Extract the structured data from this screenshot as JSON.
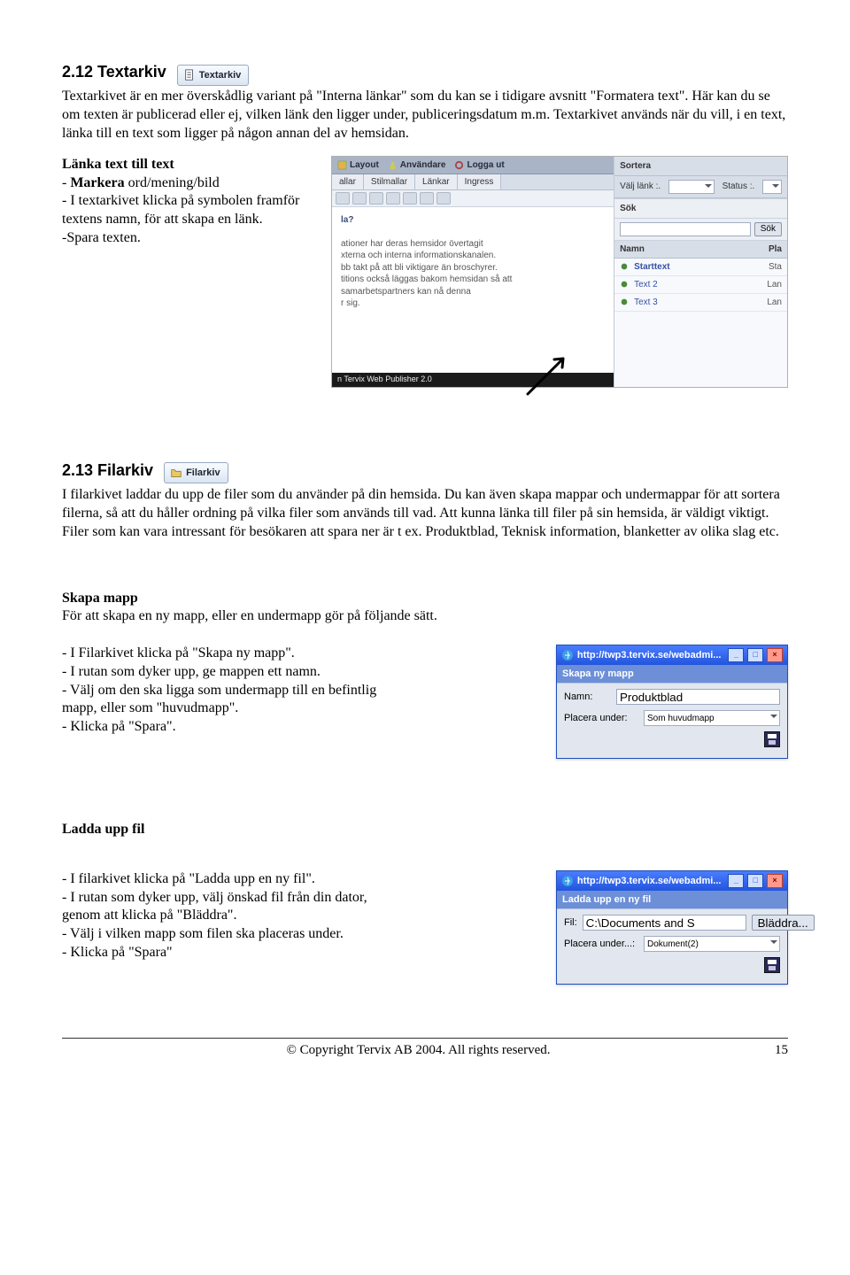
{
  "sections": {
    "textarkiv": {
      "heading": "2.12  Textarkiv",
      "badge": "Textarkiv",
      "p1": "Textarkivet är en mer överskådlig variant på \"Interna länkar\" som du kan se i tidigare avsnitt \"Formatera text\". Här kan du se om texten är publicerad eller ej, vilken länk den ligger under, publiceringsdatum m.m. Textarkivet används när du vill, i en text, länka till en text som ligger på någon annan del av hemsidan.",
      "sub_head": "Länka text till text",
      "steps": [
        "- Markera ord/mening/bild",
        "- I textarkivet klicka på symbolen framför textens namn, för att skapa en länk.",
        "-Spara texten."
      ]
    },
    "filarkiv": {
      "heading": "2.13  Filarkiv",
      "badge": "Filarkiv",
      "p1": "I filarkivet laddar du upp de filer som du använder på din hemsida. Du kan även skapa mappar och undermappar för att sortera filerna, så att du håller ordning på vilka filer som används till vad. Att kunna länka till filer på sin hemsida, är väldigt viktigt. Filer som kan vara intressant för besökaren att spara ner är t ex. Produktblad, Teknisk information, blanketter av olika slag etc.",
      "skapa_head": "Skapa mapp",
      "skapa_p": "För att skapa en ny mapp, eller en undermapp gör på följande sätt.",
      "skapa_steps": [
        "- I Filarkivet klicka på \"Skapa ny mapp\".",
        "- I rutan som dyker upp, ge mappen ett namn.",
        "- Välj om den ska ligga som undermapp till en befintlig mapp, eller som \"huvudmapp\".",
        "- Klicka på \"Spara\"."
      ],
      "ladda_head": "Ladda upp fil",
      "ladda_steps": [
        "- I filarkivet klicka på \"Ladda upp en ny fil\".",
        "- I rutan som dyker upp, välj önskad fil från din dator, genom att klicka på \"Bläddra\".",
        "- Välj i vilken mapp som filen ska placeras under.",
        "- Klicka på \"Spara\""
      ]
    }
  },
  "editor": {
    "toolbar": [
      "Layout",
      "Användare",
      "Logga ut"
    ],
    "tabs": [
      "allar",
      "Stilmallar",
      "Länkar",
      "Ingress"
    ],
    "body_q": "la?",
    "body_lines": [
      "ationer har deras hemsidor övertagit",
      "xterna och interna informationskanalen.",
      "bb takt på att bli viktigare än broschyrer.",
      "titions också läggas bakom hemsidan så att",
      "samarbetspartners kan nå denna",
      "r sig."
    ],
    "footer": "n Tervix Web Publisher 2.0",
    "right": {
      "sortera": "Sortera",
      "valj_lank": "Välj länk :.",
      "status": "Status :.",
      "sok": "Sök",
      "sok_btn": "Sök",
      "col_name": "Namn",
      "col_pla": "Pla",
      "rows": [
        {
          "txt": "Starttext",
          "hd": "Sta"
        },
        {
          "txt": "Text 2",
          "hd": "Lan"
        },
        {
          "txt": "Text 3",
          "hd": "Lan"
        }
      ]
    }
  },
  "dialogs": {
    "url": "http://twp3.tervix.se/webadmi...",
    "new_folder": {
      "title": "Skapa ny mapp",
      "name_lbl": "Namn:",
      "name_val": "Produktblad",
      "place_lbl": "Placera under:",
      "place_val": "Som huvudmapp"
    },
    "upload": {
      "title": "Ladda upp en ny fil",
      "fil_lbl": "Fil:",
      "fil_val": "C:\\Documents and S",
      "browse": "Bläddra...",
      "place_lbl": "Placera under...:",
      "place_val": "Dokument(2)"
    }
  },
  "footer": {
    "copyright": "© Copyright Tervix AB 2004. All rights reserved.",
    "page": "15"
  }
}
